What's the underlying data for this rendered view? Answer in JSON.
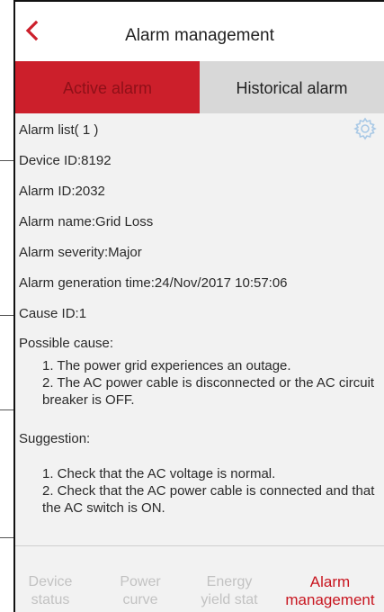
{
  "header": {
    "title": "Alarm management"
  },
  "tabs": [
    {
      "label": "Active alarm",
      "active": true
    },
    {
      "label": "Historical alarm",
      "active": false
    }
  ],
  "alarm": {
    "list_title": "Alarm list( 1 )",
    "device_id": "Device ID:8192",
    "alarm_id": "Alarm ID:2032",
    "alarm_name": "Alarm name:Grid Loss",
    "severity": "Alarm severity:Major",
    "generation_time": "Alarm generation time:24/Nov/2017 10:57:06",
    "cause_id": "Cause ID:1",
    "possible_cause_label": "Possible cause:",
    "possible_cause_1": "1. The power grid experiences an outage.",
    "possible_cause_2": "2. The AC power cable is disconnected or the AC circuit breaker is OFF.",
    "suggestion_label": "Suggestion:",
    "suggestion_1": "1. Check that the AC voltage is normal.",
    "suggestion_2": "2. Check that the AC power cable is connected and that the AC switch is ON."
  },
  "bottom_nav": [
    {
      "line1": "Device",
      "line2": "status",
      "active": false
    },
    {
      "line1": "Power",
      "line2": "curve",
      "active": false
    },
    {
      "line1": "Energy",
      "line2": "yield stat",
      "active": false
    },
    {
      "line1": "Alarm",
      "line2": "management",
      "active": true
    }
  ],
  "colors": {
    "accent": "#cc1f2b",
    "active_tab_text": "#8e1018",
    "inactive_tab_bg": "#d8d8d8",
    "nav_inactive": "#c2c2c2",
    "gear": "#a9c9e6"
  },
  "icons": {
    "back": "chevron-left-icon",
    "settings": "gear-icon"
  }
}
